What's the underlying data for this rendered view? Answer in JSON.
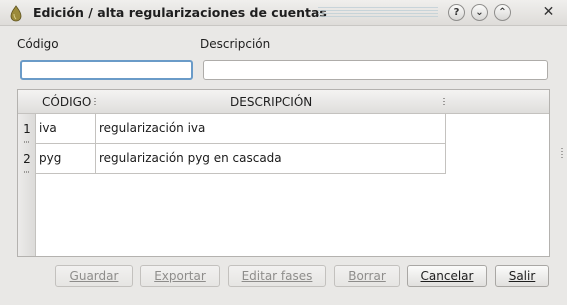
{
  "window": {
    "title": "Edición / alta regularizaciones de cuentas",
    "help_icon": "question-icon",
    "minimize_icon": "chevron-down-icon",
    "maximize_icon": "chevron-up-icon",
    "close_icon": "close-icon",
    "help_glyph": "?",
    "minimize_glyph": "⌄",
    "maximize_glyph": "⌃",
    "close_glyph": "✕"
  },
  "form": {
    "codigo_label": "Código",
    "codigo_value": "",
    "descripcion_label": "Descripción",
    "descripcion_value": ""
  },
  "table": {
    "headers": [
      "CÓDIGO",
      "DESCRIPCIÓN"
    ],
    "rows": [
      {
        "num": "1",
        "codigo": "iva",
        "descripcion": "regularización iva"
      },
      {
        "num": "2",
        "codigo": "pyg",
        "descripcion": "regularización pyg en cascada"
      }
    ]
  },
  "buttons": {
    "guardar": "Guardar",
    "exportar": "Exportar",
    "editar_fases": "Editar fases",
    "borrar": "Borrar",
    "cancelar": "Cancelar",
    "salir": "Salir"
  },
  "colors": {
    "focus_border": "#6a9bc8",
    "disabled_text": "#8e8d8b"
  }
}
